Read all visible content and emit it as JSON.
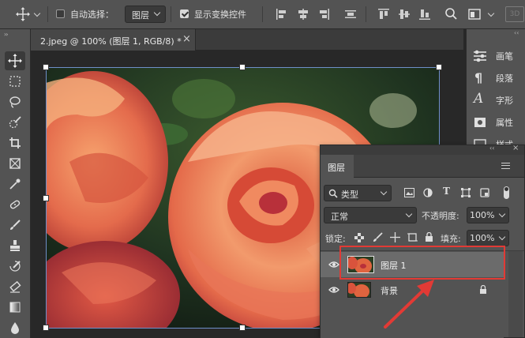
{
  "options_bar": {
    "auto_select_label": "自动选择：",
    "auto_select_checked": false,
    "auto_select_target": "图层",
    "show_transform_label": "显示变换控件",
    "show_transform_checked": true
  },
  "document_tab": {
    "title": "2.jpeg @ 100% (图层 1, RGB/8) *",
    "close_glyph": "×"
  },
  "right_dock": {
    "items": [
      {
        "label": "画笔",
        "icon": "brush-settings-icon"
      },
      {
        "label": "段落",
        "icon": "paragraph-icon"
      },
      {
        "label": "字形",
        "icon": "glyphs-icon"
      },
      {
        "label": "属性",
        "icon": "properties-icon"
      },
      {
        "label": "样式",
        "icon": "styles-icon"
      }
    ]
  },
  "layers_panel": {
    "tab_label": "图层",
    "filter_kind": "类型",
    "blend_mode": "正常",
    "opacity_label": "不透明度:",
    "opacity_value": "100%",
    "lock_label": "锁定:",
    "fill_label": "填充:",
    "fill_value": "100%",
    "layers": [
      {
        "name": "图层 1",
        "visible": true,
        "selected": true,
        "locked": false
      },
      {
        "name": "背景",
        "visible": true,
        "selected": false,
        "locked": true
      }
    ]
  },
  "colors": {
    "annotation_red": "#e23a35",
    "panel_bg": "#535353",
    "canvas_bg": "#282828"
  }
}
